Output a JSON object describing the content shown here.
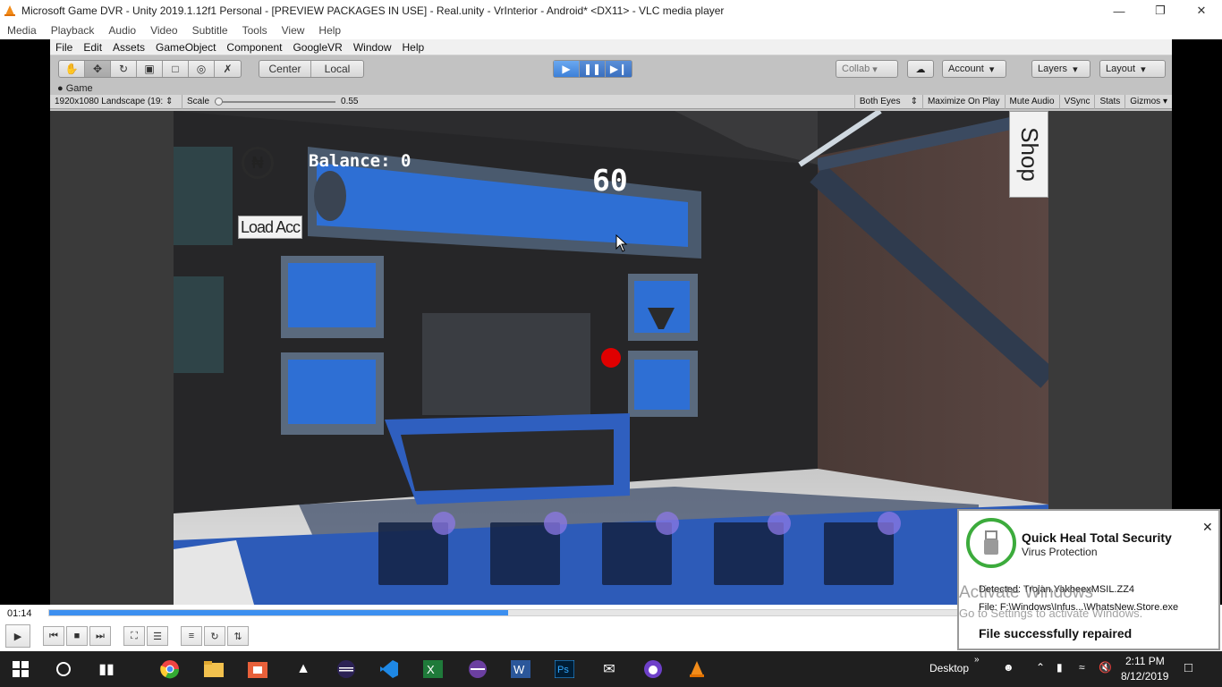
{
  "vlc": {
    "window_title": "Microsoft Game DVR - Unity 2019.1.12f1 Personal - [PREVIEW PACKAGES IN USE] - Real.unity - VrInterior - Android* <DX11> - VLC media player",
    "menu": [
      "Media",
      "Playback",
      "Audio",
      "Video",
      "Subtitle",
      "Tools",
      "View",
      "Help"
    ],
    "time_elapsed": "01:14",
    "progress": 0.395
  },
  "unity": {
    "menu": [
      "File",
      "Edit",
      "Assets",
      "GameObject",
      "Component",
      "GoogleVR",
      "Window",
      "Help"
    ],
    "pivot_center": "Center",
    "pivot_local": "Local",
    "collab": "Collab",
    "account": "Account",
    "layers": "Layers",
    "layout": "Layout",
    "game_tab": "Game",
    "resolution": "1920x1080 Landscape (19:",
    "scale_label": "Scale",
    "scale_value": "0.55",
    "both_eyes": "Both Eyes",
    "maximize_on_play": "Maximize On Play",
    "mute_audio": "Mute Audio",
    "vsync": "VSync",
    "stats": "Stats",
    "gizmos": "Gizmos"
  },
  "game": {
    "balance": "Balance: 0",
    "timer": "60",
    "load_button": "Load Acc",
    "shop_button": "Shop",
    "coin_symbol": "₦"
  },
  "taskbar": {
    "desktop_label": "Desktop",
    "time": "2:11 PM",
    "date": "8/12/2019"
  },
  "notification": {
    "title": "Quick Heal Total Security",
    "subtitle": "Virus Protection",
    "detected": "Detected: Trojan.YakbeexMSIL.ZZ4",
    "file": "File: F:\\Windows\\Infus...\\WhatsNew.Store.exe",
    "status": "File successfully repaired"
  },
  "watermark": {
    "line1": "Activate Windows",
    "line2": "Go to Settings to activate Windows."
  }
}
